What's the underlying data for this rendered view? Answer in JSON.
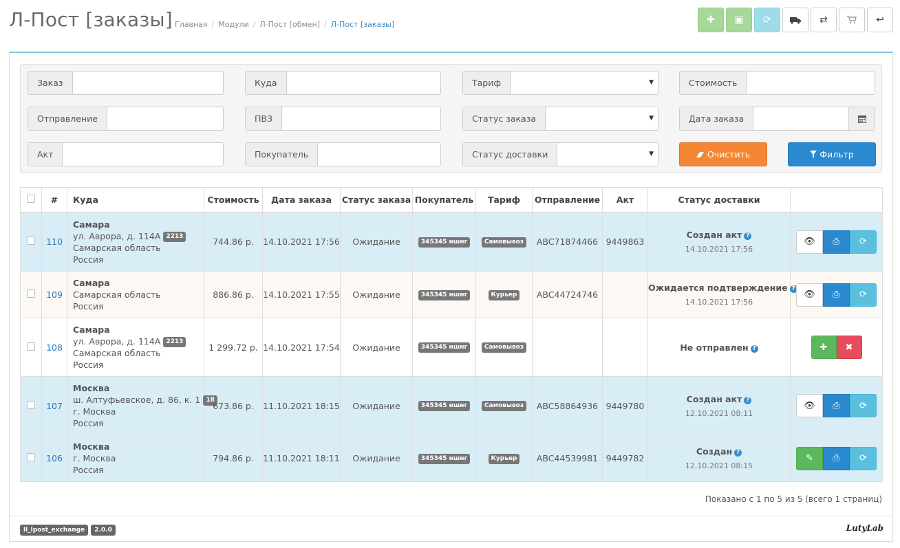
{
  "header": {
    "title": "Л-Пост [заказы]",
    "breadcrumb": [
      "Главная",
      "Модули",
      "Л-Пост [обмен]",
      "Л-Пост [заказы]"
    ]
  },
  "toolbar": {
    "buttons": [
      "add",
      "box",
      "refresh",
      "truck",
      "exchange",
      "cart",
      "back"
    ]
  },
  "filters": {
    "order_label": "Заказ",
    "order_value": "",
    "to_label": "Куда",
    "to_value": "",
    "tariff_label": "Тариф",
    "tariff_value": "",
    "cost_label": "Стоимость",
    "cost_value": "",
    "shipment_label": "Отправление",
    "shipment_value": "",
    "pvz_label": "ПВЗ",
    "pvz_value": "",
    "order_status_label": "Статус заказа",
    "order_status_value": "",
    "order_date_label": "Дата заказа",
    "order_date_value": "",
    "act_label": "Акт",
    "act_value": "",
    "buyer_label": "Покупатель",
    "buyer_value": "",
    "delivery_status_label": "Статус доставки",
    "delivery_status_value": "",
    "clear_label": "Очистить",
    "filter_label": "Фильтр"
  },
  "table": {
    "columns": [
      "#",
      "Куда",
      "Стоимость",
      "Дата заказа",
      "Статус заказа",
      "Покупатель",
      "Тариф",
      "Отправление",
      "Акт",
      "Статус доставки"
    ],
    "rows": [
      {
        "id": "110",
        "city": "Самара",
        "street": "ул. Аврора, д. 114А",
        "street_tag": "2213",
        "region": "Самарская область",
        "country": "Россия",
        "cost": "744.86 р.",
        "date": "14.10.2021 17:56",
        "order_status": "Ожидание",
        "buyer": "345345 ншнг",
        "tariff": "Самовывоз",
        "shipment": "ABC71874466",
        "act": "9449863",
        "delivery_status": "Создан акт",
        "delivery_date": "14.10.2021 17:56"
      },
      {
        "id": "109",
        "city": "Самара",
        "street": "",
        "street_tag": "",
        "region": "Самарская область",
        "country": "Россия",
        "cost": "886.86 р.",
        "date": "14.10.2021 17:55",
        "order_status": "Ожидание",
        "buyer": "345345 ншнг",
        "tariff": "Курьер",
        "shipment": "ABC44724746",
        "act": "",
        "delivery_status": "Ожидается подтверждение",
        "delivery_date": "14.10.2021 17:56"
      },
      {
        "id": "108",
        "city": "Самара",
        "street": "ул. Аврора, д. 114А",
        "street_tag": "2213",
        "region": "Самарская область",
        "country": "Россия",
        "cost": "1 299.72 р.",
        "date": "14.10.2021 17:54",
        "order_status": "Ожидание",
        "buyer": "345345 ншнг",
        "tariff": "Самовывоз",
        "shipment": "",
        "act": "",
        "delivery_status": "Не отправлен",
        "delivery_date": ""
      },
      {
        "id": "107",
        "city": "Москва",
        "street": "ш. Алтуфьевское, д. 86, к. 1",
        "street_tag": "18",
        "region": "г. Москва",
        "country": "Россия",
        "cost": "673.86 р.",
        "date": "11.10.2021 18:15",
        "order_status": "Ожидание",
        "buyer": "345345 ншнг",
        "tariff": "Самовывоз",
        "shipment": "ABC58864936",
        "act": "9449780",
        "delivery_status": "Создан акт",
        "delivery_date": "12.10.2021 08:11"
      },
      {
        "id": "106",
        "city": "Москва",
        "street": "",
        "street_tag": "",
        "region": "г. Москва",
        "country": "Россия",
        "cost": "794.86 р.",
        "date": "11.10.2021 18:11",
        "order_status": "Ожидание",
        "buyer": "345345 ншнг",
        "tariff": "Курьер",
        "shipment": "ABC44539981",
        "act": "9449782",
        "delivery_status": "Создан",
        "delivery_date": "12.10.2021 08:15"
      }
    ]
  },
  "pagination": {
    "info": "Показано с 1 по 5 из 5 (всего 1 страниц)"
  },
  "footer": {
    "module": "ll_lpost_exchange",
    "version": "2.0.0",
    "brand": "LutyLab"
  },
  "colors": {
    "accent": "#2b8acf",
    "clear": "#f38733",
    "row_highlight": "#d9edf7",
    "row_pending": "#fcf8f3"
  }
}
